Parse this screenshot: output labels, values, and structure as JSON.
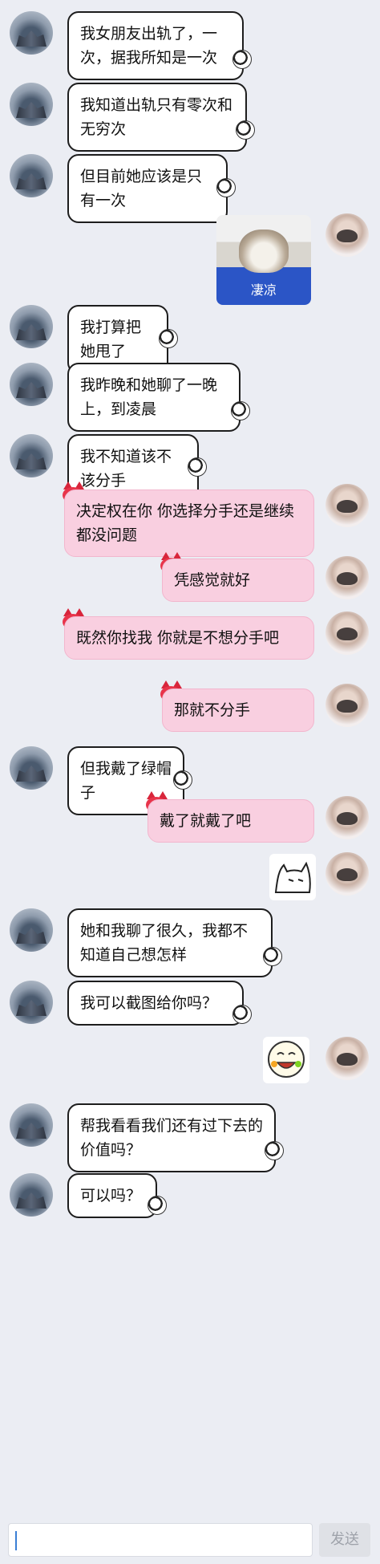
{
  "messages": [
    {
      "side": "left",
      "text": "我女朋友出轨了，一次，据我所知是一次"
    },
    {
      "side": "left",
      "text": "我知道出轨只有零次和无穷次"
    },
    {
      "side": "left",
      "text": "但目前她应该是只有一次"
    },
    {
      "side": "right",
      "type": "image",
      "caption": "凄凉"
    },
    {
      "side": "left",
      "text": "我打算把她甩了"
    },
    {
      "side": "left",
      "text": "我昨晚和她聊了一晚上，到凌晨"
    },
    {
      "side": "left",
      "text": "我不知道该不该分手"
    },
    {
      "side": "right",
      "text": "决定权在你 你选择分手还是继续都没问题"
    },
    {
      "side": "right",
      "text": "凭感觉就好"
    },
    {
      "side": "right",
      "text": "既然你找我 你就是不想分手吧"
    },
    {
      "side": "right",
      "text": "那就不分手"
    },
    {
      "side": "left",
      "text": "但我戴了绿帽子"
    },
    {
      "side": "right",
      "text": "戴了就戴了吧"
    },
    {
      "side": "right",
      "type": "sticker",
      "icon": "cat-doodle-sticker"
    },
    {
      "side": "left",
      "text": "她和我聊了很久，我都不知道自己想怎样"
    },
    {
      "side": "left",
      "text": "我可以截图给你吗？"
    },
    {
      "side": "right",
      "type": "sticker",
      "icon": "laughing-face-sticker"
    },
    {
      "side": "left",
      "text": "帮我看看我们还有过下去的价值吗？"
    },
    {
      "side": "left",
      "text": "可以吗？"
    }
  ],
  "input": {
    "placeholder": ""
  },
  "send_label": "发送"
}
